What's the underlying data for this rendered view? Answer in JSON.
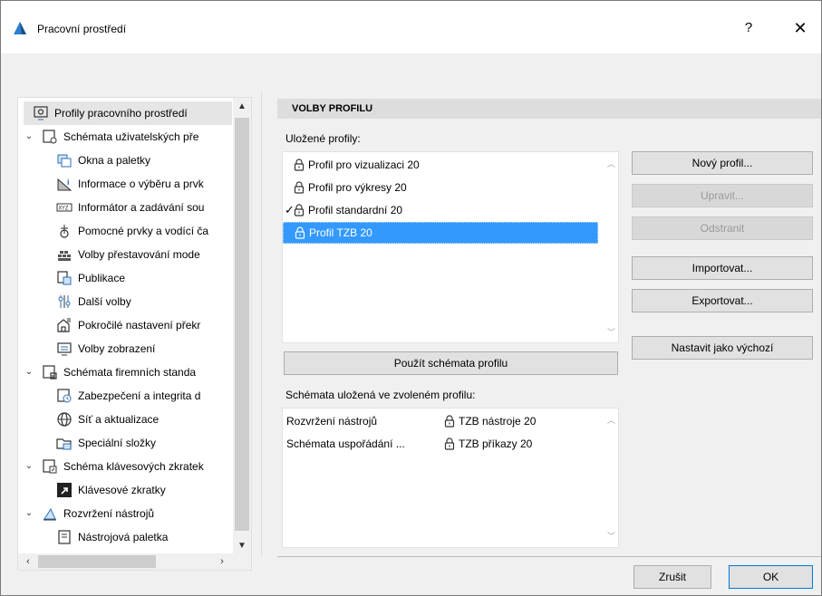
{
  "window": {
    "title": "Pracovní prostředí",
    "help": "?",
    "close": "✕"
  },
  "tree": {
    "items": [
      {
        "label": "Profily pracovního prostředí",
        "level": 0,
        "icon": "profiles-icon",
        "selected": true
      },
      {
        "label": "Schémata uživatelských pře",
        "level": 0,
        "icon": "user-schemes-icon",
        "expanded": true
      },
      {
        "label": "Okna a paletky",
        "level": 1,
        "icon": "windows-palettes-icon"
      },
      {
        "label": "Informace o výběru a prvk",
        "level": 1,
        "icon": "selection-info-icon"
      },
      {
        "label": "Informátor a zadávání sou",
        "level": 1,
        "icon": "xyz-icon"
      },
      {
        "label": "Pomocné prvky a vodící ča",
        "level": 1,
        "icon": "helper-icon"
      },
      {
        "label": "Volby přestavování mode",
        "level": 1,
        "icon": "rebuild-icon"
      },
      {
        "label": "Publikace",
        "level": 1,
        "icon": "publish-icon"
      },
      {
        "label": "Další volby",
        "level": 1,
        "icon": "more-options-icon"
      },
      {
        "label": "Pokročilé nastavení překr",
        "level": 1,
        "icon": "advanced-icon"
      },
      {
        "label": "Volby zobrazení",
        "level": 1,
        "icon": "display-icon"
      },
      {
        "label": "Schémata firemních standa",
        "level": 0,
        "icon": "company-schemes-icon",
        "expanded": true
      },
      {
        "label": "Zabezpečení a integrita d",
        "level": 1,
        "icon": "security-icon"
      },
      {
        "label": "Síť a aktualizace",
        "level": 1,
        "icon": "globe-icon"
      },
      {
        "label": "Speciální složky",
        "level": 1,
        "icon": "folder-icon"
      },
      {
        "label": "Schéma klávesových zkratek",
        "level": 0,
        "icon": "shortcut-scheme-icon",
        "expanded": true
      },
      {
        "label": "Klávesové zkratky",
        "level": 1,
        "icon": "shortcut-icon"
      },
      {
        "label": "Rozvržení nástrojů",
        "level": 0,
        "icon": "tools-layout-icon",
        "expanded": true
      },
      {
        "label": "Nástrojová paletka",
        "level": 1,
        "icon": "toolbox-icon"
      }
    ]
  },
  "panel": {
    "header": "VOLBY PROFILU",
    "saved_profiles_label": "Uložené profily:",
    "profiles": [
      {
        "label": "Profil pro vizualizaci 20",
        "checked": false,
        "selected": false
      },
      {
        "label": "Profil pro výkresy 20",
        "checked": false,
        "selected": false
      },
      {
        "label": "Profil standardní 20",
        "checked": true,
        "selected": false
      },
      {
        "label": "Profil TZB 20",
        "checked": false,
        "selected": true
      }
    ],
    "check_mark": "✓",
    "buttons": {
      "new": "Nový profil...",
      "edit": "Upravit...",
      "delete": "Odstranit",
      "import": "Importovat...",
      "export": "Exportovat...",
      "set_default": "Nastavit jako výchozí",
      "apply": "Použít schémata profilu"
    },
    "schemes_label": "Schémata uložená ve zvoleném profilu:",
    "schemes": [
      {
        "name": "Rozvržení nástrojů",
        "value": "TZB nástroje 20"
      },
      {
        "name": "Schémata uspořádání ...",
        "value": "TZB příkazy 20"
      }
    ]
  },
  "footer": {
    "cancel": "Zrušit",
    "ok": "OK"
  }
}
